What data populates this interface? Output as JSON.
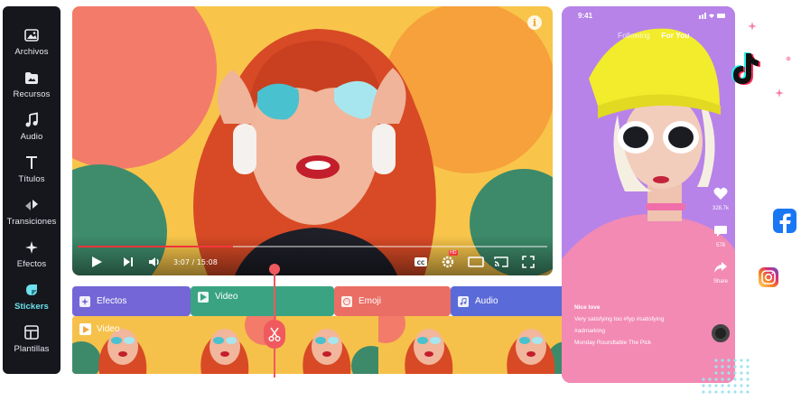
{
  "sidebar": {
    "items": [
      {
        "label": "Archivos",
        "icon": "image-icon"
      },
      {
        "label": "Recursos",
        "icon": "folder-image-icon"
      },
      {
        "label": "Audio",
        "icon": "music-note-icon"
      },
      {
        "label": "Títulos",
        "icon": "text-t-icon"
      },
      {
        "label": "Transiciones",
        "icon": "transition-arrows-icon"
      },
      {
        "label": "Efectos",
        "icon": "sparkle-icon"
      },
      {
        "label": "Stickers",
        "icon": "sticker-icon"
      },
      {
        "label": "Plantillas",
        "icon": "template-icon"
      }
    ],
    "active": "Stickers",
    "accent": "#6ee0ee"
  },
  "player": {
    "time": "3:07 / 15:08",
    "progress": 0.33,
    "progress_color": "#f3353d",
    "info_glyph": "i",
    "hd_badge": "HD"
  },
  "timeline": {
    "tracks": [
      {
        "label": "Efectos",
        "color": "#7466d6",
        "icon": "sparkle-icon"
      },
      {
        "label": "Video",
        "color": "#3aa482",
        "icon": "play-icon"
      },
      {
        "label": "Emoji",
        "color": "#ea6e64",
        "icon": "emoji-icon"
      },
      {
        "label": "Audio",
        "color": "#5a6ad8",
        "icon": "music-note-icon"
      }
    ],
    "strip_label": "Video",
    "playhead_color": "#f05a5e"
  },
  "phone": {
    "status_time": "9:41",
    "tabs": [
      "Following",
      "For You"
    ],
    "selected_tab": "For You",
    "counts": {
      "likes": "328.7k",
      "comments": "578",
      "share": "Share"
    },
    "caption_user": "Nice love",
    "caption_text": "Very satisfying too #fyp #satisfying",
    "caption_tags": "#admarking",
    "caption_sound": "Monday Roundtable  The Pick"
  },
  "brands": {
    "tiktok": "tiktok-logo-icon",
    "facebook": "facebook-logo-icon",
    "instagram": "instagram-logo-icon"
  }
}
